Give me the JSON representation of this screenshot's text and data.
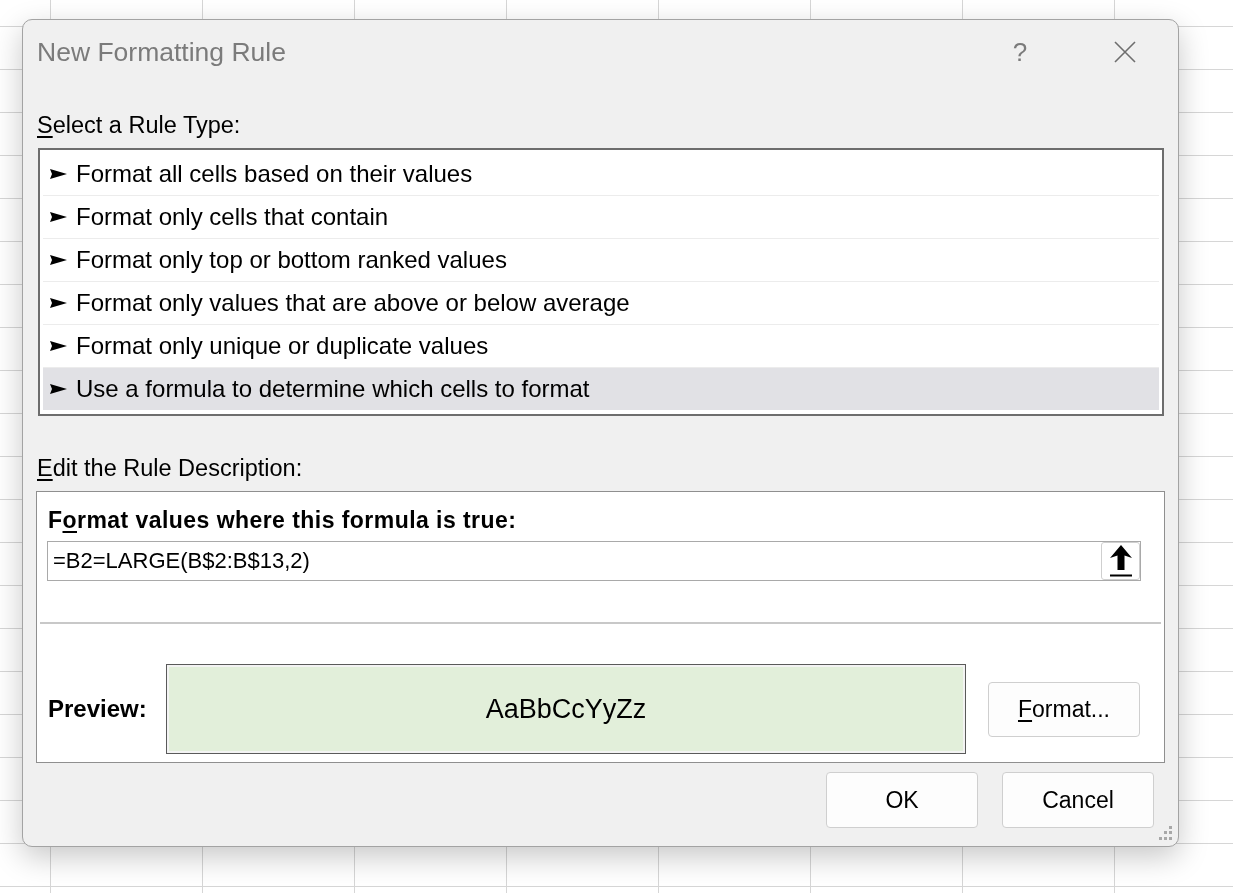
{
  "window": {
    "title": "New Formatting Rule",
    "help": "?"
  },
  "rule_type_section": {
    "label": {
      "key": "S",
      "rest": "elect a Rule Type:"
    },
    "items": [
      {
        "label": "Format all cells based on their values",
        "selected": false
      },
      {
        "label": "Format only cells that contain",
        "selected": false
      },
      {
        "label": "Format only top or bottom ranked values",
        "selected": false
      },
      {
        "label": "Format only values that are above or below average",
        "selected": false
      },
      {
        "label": "Format only unique or duplicate values",
        "selected": false
      },
      {
        "label": "Use a formula to determine which cells to format",
        "selected": true
      }
    ]
  },
  "description_section": {
    "label": {
      "key": "E",
      "rest": "dit the Rule Description:"
    },
    "formula_label": {
      "lead": "F",
      "key": "o",
      "rest": "rmat values where this formula is true:"
    },
    "formula": {
      "value": "=B2=LARGE(B$2:B$13,2)"
    },
    "preview_label": "Preview:",
    "preview_sample": "AaBbCcYyZz",
    "format_button": {
      "label": {
        "key": "F",
        "rest": "ormat..."
      }
    }
  },
  "buttons": [
    {
      "label": "OK"
    },
    {
      "label": "Cancel"
    }
  ]
}
